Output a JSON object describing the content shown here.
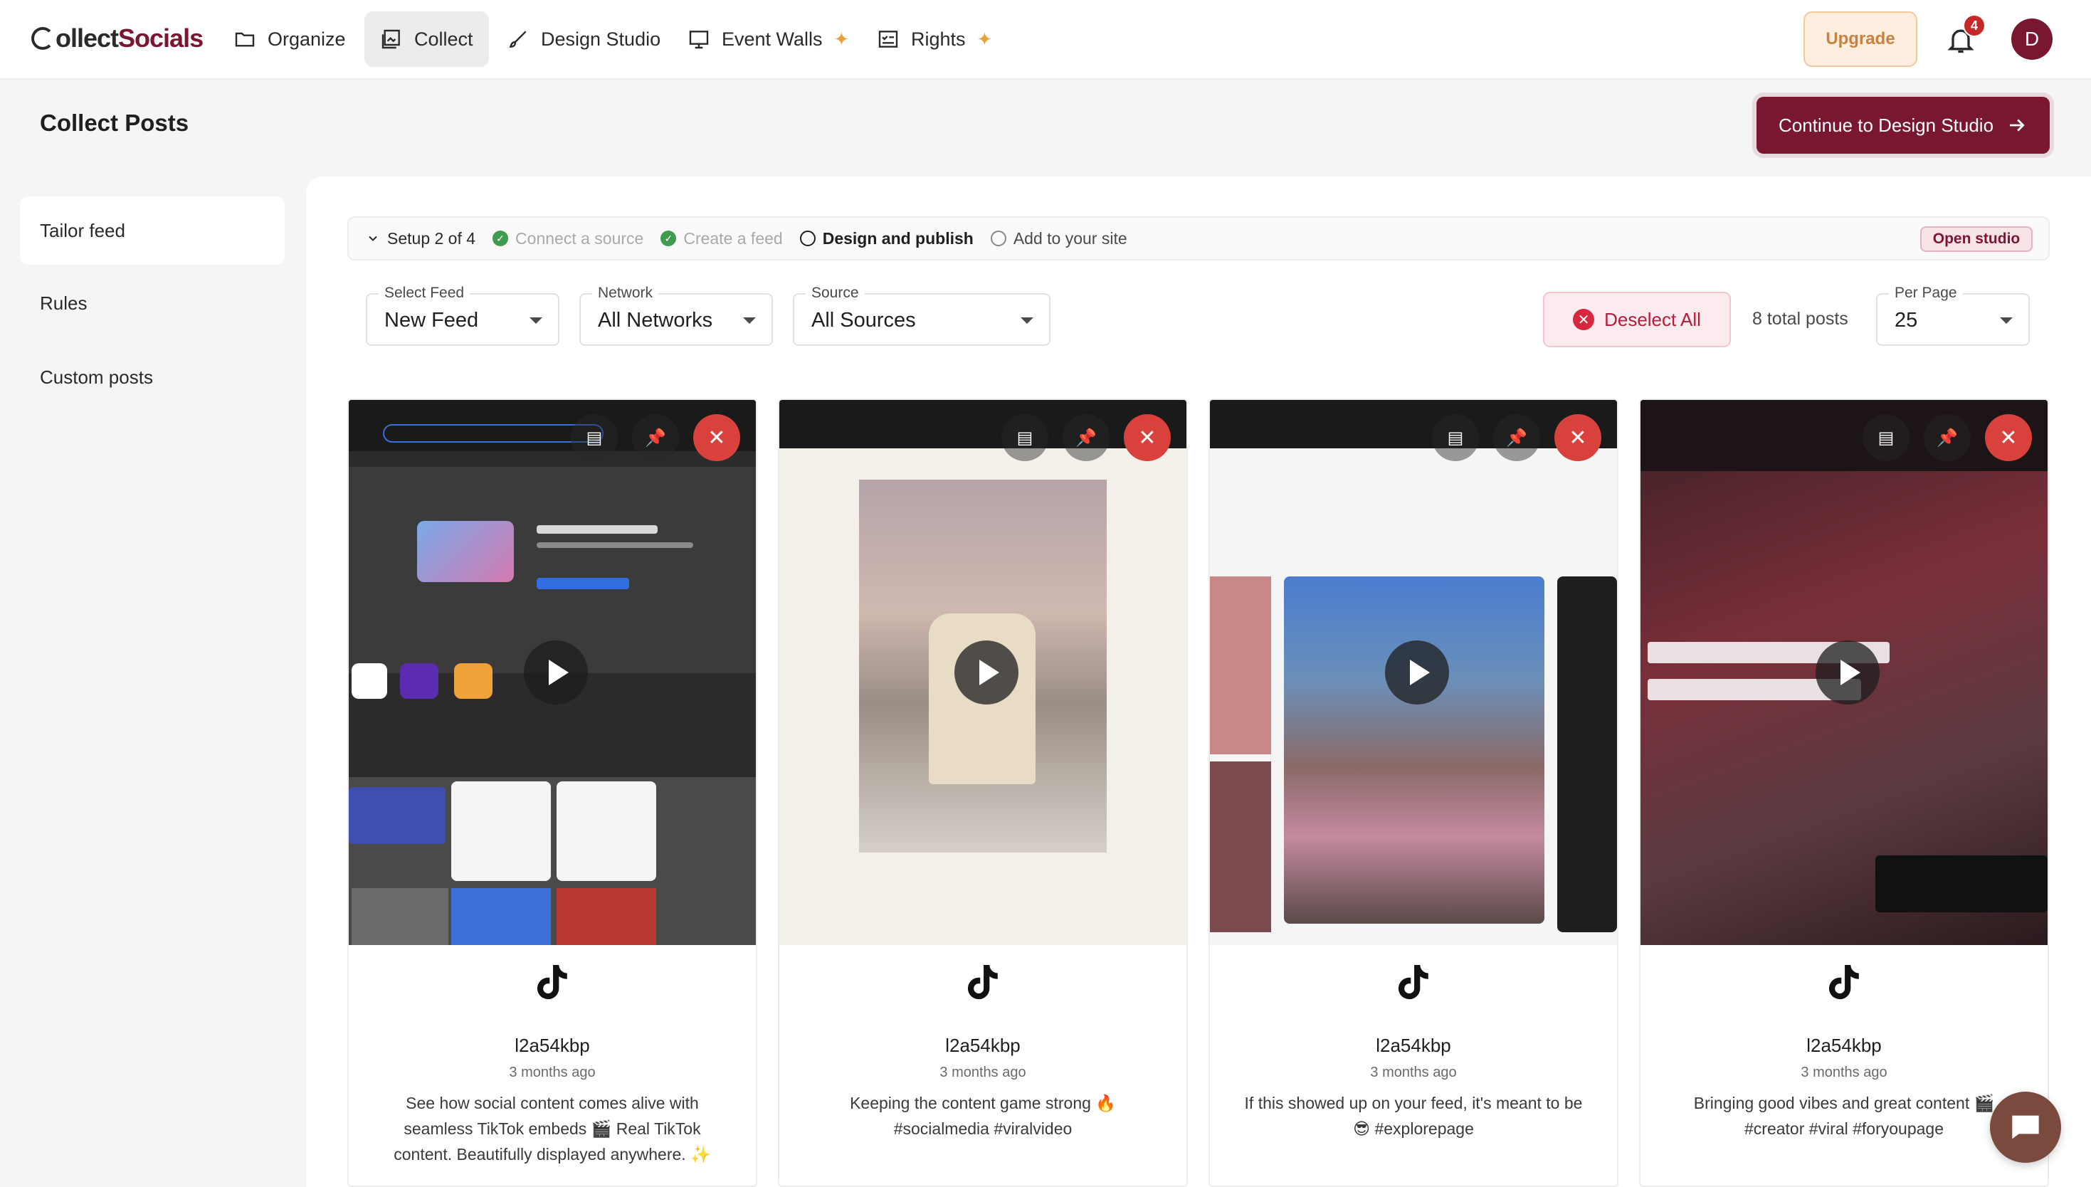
{
  "brand": {
    "logo_part1": "ollect",
    "logo_part2": "Socials",
    "accent": "#7a1730"
  },
  "nav": {
    "items": [
      {
        "label": "Organize",
        "icon": "folder-icon"
      },
      {
        "label": "Collect",
        "icon": "collect-icon",
        "active": true
      },
      {
        "label": "Design Studio",
        "icon": "brush-icon"
      },
      {
        "label": "Event Walls",
        "icon": "monitor-icon",
        "sparkle": true
      },
      {
        "label": "Rights",
        "icon": "rights-icon",
        "sparkle": true
      }
    ],
    "upgrade": "Upgrade",
    "notifications": "4",
    "avatar": "D"
  },
  "page": {
    "title": "Collect Posts",
    "cta": "Continue to Design Studio"
  },
  "sidebar": {
    "items": [
      {
        "label": "Tailor feed",
        "active": true
      },
      {
        "label": "Rules"
      },
      {
        "label": "Custom posts"
      }
    ]
  },
  "setup": {
    "title": "Setup 2 of 4",
    "steps": [
      {
        "label": "Connect a source",
        "state": "done"
      },
      {
        "label": "Create a feed",
        "state": "done"
      },
      {
        "label": "Design and publish",
        "state": "current"
      },
      {
        "label": "Add to your site",
        "state": "todo"
      }
    ],
    "open_studio": "Open studio"
  },
  "filters": {
    "feed": {
      "label": "Select Feed",
      "value": "New Feed"
    },
    "network": {
      "label": "Network",
      "value": "All Networks"
    },
    "source": {
      "label": "Source",
      "value": "All Sources"
    },
    "deselect": "Deselect All",
    "total": "8 total posts",
    "per_page": {
      "label": "Per Page",
      "value": "25"
    }
  },
  "posts": [
    {
      "author": "l2a54kbp",
      "time": "3 months ago",
      "caption": "See how social content comes alive with seamless TikTok embeds 🎬 Real TikTok content. Beautifully displayed anywhere. ✨",
      "network": "tiktok-icon"
    },
    {
      "author": "l2a54kbp",
      "time": "3 months ago",
      "caption": "Keeping the content game strong 🔥 #socialmedia #viralvideo",
      "network": "tiktok-icon"
    },
    {
      "author": "l2a54kbp",
      "time": "3 months ago",
      "caption": "If this showed up on your feed, it's meant to be 😎 #explorepage",
      "network": "tiktok-icon"
    },
    {
      "author": "l2a54kbp",
      "time": "3 months ago",
      "caption": "Bringing good vibes and great content 🎬 #creator #viral #foryoupage",
      "network": "tiktok-icon"
    }
  ]
}
